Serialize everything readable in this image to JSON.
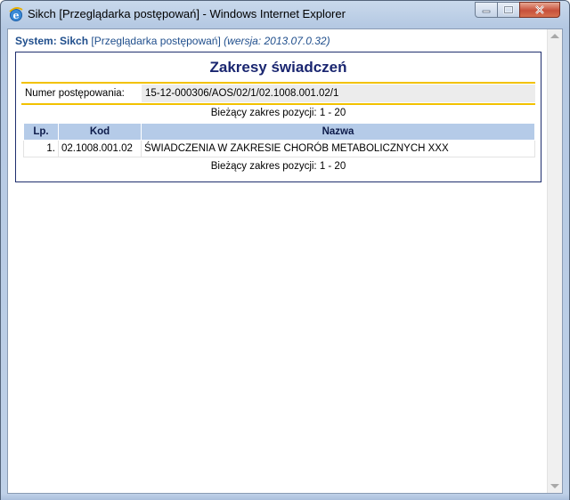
{
  "window": {
    "title": "Sikch [Przeglądarka postępowań] - Windows Internet Explorer"
  },
  "system_line": {
    "label": "System: Sikch",
    "app": "[Przeglądarka postępowań]",
    "version": "(wersja: 2013.07.0.32)"
  },
  "panel": {
    "title": "Zakresy świadczeń",
    "numer_label": "Numer postępowania:",
    "numer_value": "15-12-000306/AOS/02/1/02.1008.001.02/1",
    "range_top": "Bieżący zakres pozycji: 1 - 20",
    "range_bottom": "Bieżący zakres pozycji: 1 - 20"
  },
  "table": {
    "headers": {
      "lp": "Lp.",
      "kod": "Kod",
      "nazwa": "Nazwa"
    },
    "rows": [
      {
        "lp": "1.",
        "kod": "02.1008.001.02",
        "nazwa": "ŚWIADCZENIA W ZAKRESIE CHORÓB METABOLICZNYCH XXX"
      }
    ]
  },
  "colors": {
    "header_bg": "#b5cbe8",
    "title_color": "#1a2670",
    "accent_gold": "#f2c200"
  }
}
